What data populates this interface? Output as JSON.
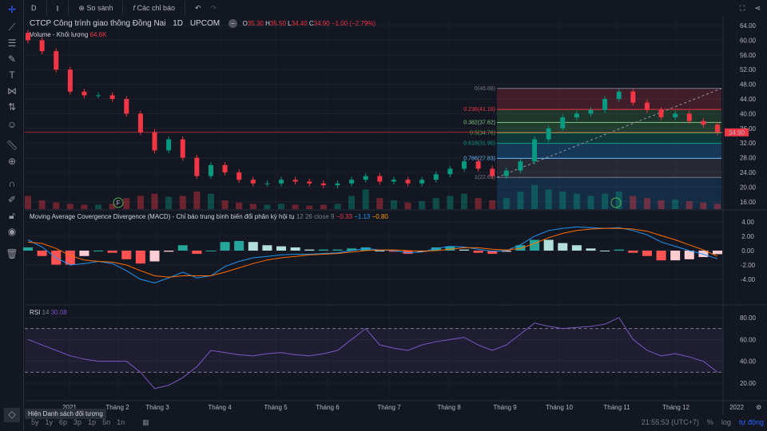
{
  "toolbar": {
    "interval": "D",
    "compare": "So sánh",
    "indicators": "Các chỉ báo"
  },
  "symbol": {
    "name": "CTCP Công trình giao thông Đồng Nai",
    "interval": "1D",
    "exchange": "UPCOM",
    "o_label": "O",
    "o": "35.30",
    "h_label": "H",
    "h": "35.50",
    "l_label": "L",
    "l": "34.40",
    "c_label": "C",
    "c": "34.90",
    "change": "−1.00 (−2.79%)"
  },
  "volume": {
    "label": "Volume - Khối lượng",
    "value": "64.6K"
  },
  "macd": {
    "label": "Moving Average Covergence Divergence (MACD) - Chỉ báo trung bình biến đổi phân kỳ hội tụ",
    "params": "12 26 close 9",
    "hist": "−0.33",
    "macd": "−1.13",
    "signal": "−0.80"
  },
  "rsi": {
    "label": "RSI",
    "param": "14",
    "value": "30.08"
  },
  "price_scale": [
    "64.00",
    "60.00",
    "56.00",
    "52.00",
    "48.00",
    "44.00",
    "40.00",
    "36.00",
    "32.00",
    "28.00",
    "24.00",
    "20.00",
    "16.00"
  ],
  "last_price": "34.90",
  "macd_scale": [
    "4.00",
    "2.00",
    "0.00",
    "-2.00",
    "-4.00"
  ],
  "rsi_scale": [
    "80.00",
    "60.00",
    "40.00",
    "20.00"
  ],
  "time_axis": [
    "2021",
    "Tháng 2",
    "Tháng 3",
    "Tháng 4",
    "Tháng 5",
    "Tháng 6",
    "Tháng 7",
    "Tháng 8",
    "Tháng 9",
    "Tháng 10",
    "Tháng 11",
    "Tháng 12",
    "2022"
  ],
  "fib_levels": [
    {
      "label": "0(46.88)",
      "price": 46.88,
      "color": "#787b86"
    },
    {
      "label": "0.236(41.16)",
      "price": 41.16,
      "color": "#f23645"
    },
    {
      "label": "0.382(37.62)",
      "price": 37.62,
      "color": "#81c784"
    },
    {
      "label": "0.5(34.76)",
      "price": 34.76,
      "color": "#4caf50"
    },
    {
      "label": "0.618(31.90)",
      "price": 31.9,
      "color": "#089981"
    },
    {
      "label": "0.786(27.83)",
      "price": 27.83,
      "color": "#64b5f6"
    },
    {
      "label": "1(22.65)",
      "price": 22.65,
      "color": "#787b86"
    }
  ],
  "chart_data": {
    "type": "candlestick",
    "closes": [
      60,
      57,
      52,
      46,
      45,
      45,
      44,
      40,
      35,
      30,
      33,
      28,
      23,
      26,
      24,
      22,
      21,
      21,
      22,
      21.5,
      21,
      20.5,
      21,
      22,
      23,
      21.5,
      22,
      21,
      22,
      23.5,
      25,
      27,
      25,
      23,
      24.5,
      27,
      33,
      36,
      39,
      40,
      41,
      44,
      46,
      43,
      41,
      39,
      40,
      38,
      37,
      34.9
    ],
    "volumes": [
      30,
      20,
      15,
      12,
      10,
      10,
      12,
      25,
      30,
      35,
      28,
      30,
      40,
      35,
      20,
      15,
      12,
      10,
      12,
      10,
      8,
      10,
      12,
      30,
      45,
      25,
      20,
      15,
      18,
      25,
      30,
      35,
      25,
      20,
      25,
      40,
      55,
      45,
      40,
      35,
      30,
      35,
      40,
      30,
      25,
      20,
      22,
      18,
      15,
      12
    ],
    "macd": [
      1.5,
      0.5,
      -1,
      -2,
      -1.8,
      -1.5,
      -1.8,
      -2.8,
      -4,
      -4.5,
      -3.8,
      -3,
      -3.8,
      -3.5,
      -2.2,
      -1.5,
      -1,
      -0.8,
      -0.6,
      -0.5,
      -0.5,
      -0.4,
      -0.3,
      0,
      0.3,
      0.1,
      0,
      -0.3,
      -0.2,
      0.3,
      0.6,
      0.5,
      0.2,
      -0.1,
      0,
      0.8,
      2,
      2.8,
      3.1,
      3.3,
      3.2,
      3.1,
      3.2,
      2.8,
      2.2,
      1.2,
      0.6,
      0,
      -0.5,
      -1.13
    ],
    "signal": [
      1.2,
      1,
      0.3,
      -0.7,
      -1.3,
      -1.5,
      -1.6,
      -2,
      -2.8,
      -3.5,
      -3.7,
      -3.5,
      -3.5,
      -3.5,
      -3,
      -2.4,
      -1.8,
      -1.3,
      -1,
      -0.8,
      -0.6,
      -0.5,
      -0.4,
      -0.2,
      0,
      0.1,
      0.1,
      0,
      -0.1,
      0,
      0.2,
      0.4,
      0.4,
      0.2,
      0.1,
      0.3,
      1,
      1.8,
      2.4,
      2.8,
      3,
      3.1,
      3.1,
      3,
      2.7,
      2.1,
      1.5,
      0.8,
      0.1,
      -0.8
    ],
    "rsi": [
      60,
      55,
      50,
      45,
      42,
      40,
      40,
      40,
      30,
      15,
      18,
      25,
      35,
      50,
      48,
      46,
      45,
      47,
      48,
      46,
      45,
      47,
      50,
      60,
      70,
      55,
      52,
      50,
      55,
      58,
      60,
      62,
      55,
      50,
      55,
      65,
      75,
      72,
      70,
      71,
      72,
      74,
      80,
      60,
      50,
      45,
      47,
      44,
      40,
      30.08
    ],
    "ylim": [
      16,
      64
    ],
    "macd_ylim": [
      -4,
      4
    ],
    "rsi_ylim": [
      20,
      80
    ]
  },
  "bottom": {
    "ranges": [
      "5y",
      "1y",
      "6p",
      "3p",
      "1p",
      "5n",
      "1n"
    ],
    "clock": "21:55:53 (UTC+7)",
    "percent": "%",
    "log": "log",
    "auto": "tự động",
    "tooltip": "Hiện Danh sách đối tượng"
  }
}
